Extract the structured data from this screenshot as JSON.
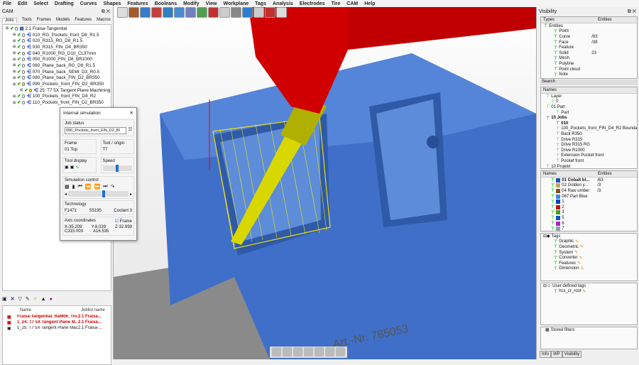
{
  "menu": [
    "File",
    "Edit",
    "Select",
    "Drafting",
    "Curves",
    "Shapes",
    "Features",
    "Booleans",
    "Modify",
    "View",
    "Workplane",
    "Tags",
    "Analysis",
    "Electrodes",
    "Tire",
    "CAM",
    "Help"
  ],
  "left": {
    "title": "CAM",
    "tabs": [
      "Jobs",
      "Tools",
      "Frames",
      "Models",
      "Features",
      "Macros"
    ],
    "tree": [
      {
        "label": "2.1 Fraisa-Tangential",
        "level": 0
      },
      {
        "label": "010_RG_Pockets_front_D8_R1.5",
        "level": 1
      },
      {
        "label": "020_R315_RG_D8_R1.5",
        "level": 1
      },
      {
        "label": "030_R315_FIN_D4_BR350",
        "level": 1
      },
      {
        "label": "040_R1000_RG_D10_CL37mm",
        "level": 1
      },
      {
        "label": "050_R1000_FIN_D8_BR1000",
        "level": 1
      },
      {
        "label": "060_Plane_back_RG_D8_R1.5",
        "level": 1
      },
      {
        "label": "070_Plane_back_SEMI_D3_R0.5",
        "level": 1
      },
      {
        "label": "080_Plane_back_FIN_D2_BR350",
        "level": 1
      },
      {
        "label": "090_Pockets_front_FIN_D2_BR350",
        "level": 1
      },
      {
        "label": "25: T7 5X Tangent Plane Machining",
        "level": 2
      },
      {
        "label": "100_Pockets_front_FIN_D4_R2",
        "level": 1
      },
      {
        "label": "110_Pockets_front_FIN_D2_BR350",
        "level": 1
      }
    ],
    "list": {
      "headers": [
        "Name",
        "Joblist name"
      ],
      "rows": [
        {
          "name": "Fraisa-Tangential_RaM06_Tru...",
          "job": "2.1 Fraisa...",
          "red": true
        },
        {
          "name": "1_24: T7 5X Tangent Plane M...",
          "job": "2.1 Fraisa...",
          "red": true
        },
        {
          "name": "1_25: T7 5X Tangent Plane Machining",
          "job": "2.1 Fraisa-...",
          "red": false
        }
      ]
    }
  },
  "sim": {
    "title": "Internal simulation",
    "job_status_label": "Job status",
    "job_status": "090_Pockets_front_FIN_D2_BI",
    "frame_label": "Frame",
    "frame": "01 Top",
    "tool_label": "Tool / origin",
    "tool": "T7",
    "tool_display_label": "Tool display",
    "speed_label": "Speed",
    "speed": 0.5,
    "sim_control_label": "Simulation control",
    "progress": 0.6,
    "tech_label": "Technology",
    "feed": "F1471",
    "spindle": "S5195",
    "coolant": "Coolant  3",
    "axis_label": "Axis coordinates",
    "frame_check": "Frame",
    "x": "X-35.209",
    "y": "Y-8.039",
    "z": "Z-32.999",
    "c": "C315.003",
    "a": "A16.535"
  },
  "view": {
    "part_text": "Art.-Nr. 785053"
  },
  "right": {
    "title": "Visibility",
    "types_hdr": [
      "Types",
      "Entities"
    ],
    "types": [
      {
        "label": "Entities",
        "count": ""
      },
      {
        "label": "Point",
        "count": ""
      },
      {
        "label": "Curve",
        "count": "/83"
      },
      {
        "label": "Face",
        "count": "/38"
      },
      {
        "label": "Feature",
        "count": ""
      },
      {
        "label": "Solid",
        "count": "23"
      },
      {
        "label": "Mesh",
        "count": ""
      },
      {
        "label": "Polyline",
        "count": ""
      },
      {
        "label": "Point cloud",
        "count": ""
      },
      {
        "label": "Note",
        "count": ""
      }
    ],
    "search": "Search",
    "names_hdr": "Names",
    "layers": [
      "Layer",
      "0",
      "01 Part",
      "Part",
      "10 Jobs",
      "010",
      "100_Pockets_front_FIN_D4_R2 Boundar",
      "Back R350",
      "Drive R315",
      "Drive R315 RG",
      "Drive R1000",
      "Extension Pocket front",
      "Pocket front",
      "10 Projekt"
    ],
    "colors_hdr": [
      "Names",
      "Entities"
    ],
    "colors": [
      {
        "label": "01 Cobalt bl...",
        "count": "/63",
        "c": "#1d4fb0"
      },
      {
        "label": "02 Golden y...",
        "count": "/3",
        "c": "#c8a060"
      },
      {
        "label": "04 Raw umber",
        "count": "/3",
        "c": "#8a5020"
      },
      {
        "label": "067 Part Blue",
        "count": "",
        "c": "#3a8ae0"
      },
      {
        "label": "1",
        "count": "",
        "c": "#1040c0"
      },
      {
        "label": "2",
        "count": "",
        "c": "#c01010"
      },
      {
        "label": "3",
        "count": "",
        "c": "#40a020"
      },
      {
        "label": "5",
        "count": "",
        "c": "#1050d0"
      },
      {
        "label": "6",
        "count": "",
        "c": "#b020c0"
      },
      {
        "label": "7",
        "count": "",
        "c": "#90a0b0"
      }
    ],
    "tags": [
      "Tags",
      "Graphic",
      "Geometric",
      "System",
      "Converter",
      "Features",
      "Dimension"
    ],
    "user_tags": [
      "User defined tags",
      "hcs_cr_root"
    ],
    "stored": "Stored filters",
    "bottom_tabs": [
      "Info",
      "WP",
      "Visibility"
    ]
  }
}
